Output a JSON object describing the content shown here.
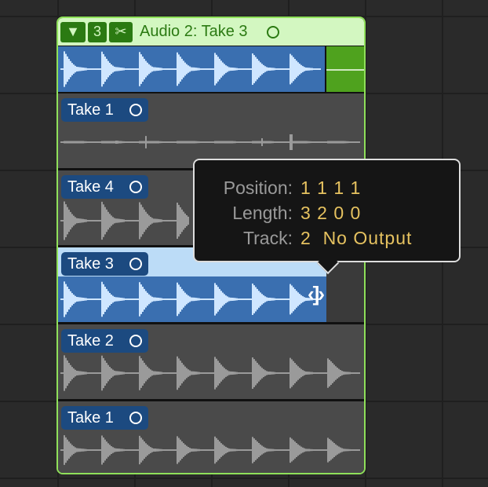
{
  "folder": {
    "collapse_icon": "triangle-down-icon",
    "take_count": "3",
    "scissors_icon": "scissors-icon",
    "title": "Audio 2: Take 3"
  },
  "lanes": [
    {
      "label": "Take 1"
    },
    {
      "label": "Take 4"
    },
    {
      "label": "Take 3"
    },
    {
      "label": "Take 2"
    },
    {
      "label": "Take 1"
    }
  ],
  "tooltip": {
    "position_label": "Position:",
    "position_value": "1 1 1 1",
    "length_label": "Length:",
    "length_value": "3 2 0 0",
    "track_label": "Track:",
    "track_value": "2  No Output"
  },
  "colors": {
    "folder_green": "#8fe05a",
    "take_blue": "#1c4a80",
    "selected_wave": "#3a6fb0",
    "value_gold": "#e6c260"
  }
}
